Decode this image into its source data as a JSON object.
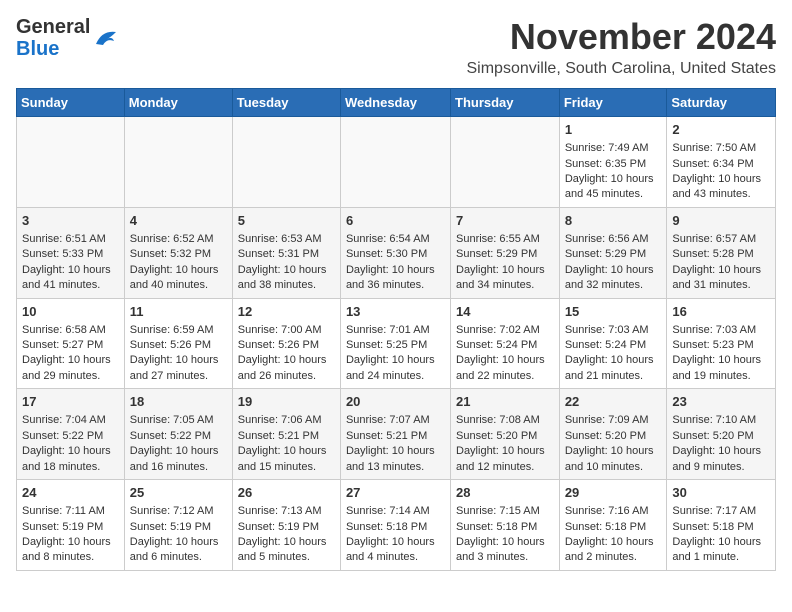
{
  "logo": {
    "line1": "General",
    "line2": "Blue"
  },
  "title": "November 2024",
  "location": "Simpsonville, South Carolina, United States",
  "weekdays": [
    "Sunday",
    "Monday",
    "Tuesday",
    "Wednesday",
    "Thursday",
    "Friday",
    "Saturday"
  ],
  "weeks": [
    [
      {
        "day": "",
        "data": ""
      },
      {
        "day": "",
        "data": ""
      },
      {
        "day": "",
        "data": ""
      },
      {
        "day": "",
        "data": ""
      },
      {
        "day": "",
        "data": ""
      },
      {
        "day": "1",
        "data": "Sunrise: 7:49 AM\nSunset: 6:35 PM\nDaylight: 10 hours and 45 minutes."
      },
      {
        "day": "2",
        "data": "Sunrise: 7:50 AM\nSunset: 6:34 PM\nDaylight: 10 hours and 43 minutes."
      }
    ],
    [
      {
        "day": "3",
        "data": "Sunrise: 6:51 AM\nSunset: 5:33 PM\nDaylight: 10 hours and 41 minutes."
      },
      {
        "day": "4",
        "data": "Sunrise: 6:52 AM\nSunset: 5:32 PM\nDaylight: 10 hours and 40 minutes."
      },
      {
        "day": "5",
        "data": "Sunrise: 6:53 AM\nSunset: 5:31 PM\nDaylight: 10 hours and 38 minutes."
      },
      {
        "day": "6",
        "data": "Sunrise: 6:54 AM\nSunset: 5:30 PM\nDaylight: 10 hours and 36 minutes."
      },
      {
        "day": "7",
        "data": "Sunrise: 6:55 AM\nSunset: 5:29 PM\nDaylight: 10 hours and 34 minutes."
      },
      {
        "day": "8",
        "data": "Sunrise: 6:56 AM\nSunset: 5:29 PM\nDaylight: 10 hours and 32 minutes."
      },
      {
        "day": "9",
        "data": "Sunrise: 6:57 AM\nSunset: 5:28 PM\nDaylight: 10 hours and 31 minutes."
      }
    ],
    [
      {
        "day": "10",
        "data": "Sunrise: 6:58 AM\nSunset: 5:27 PM\nDaylight: 10 hours and 29 minutes."
      },
      {
        "day": "11",
        "data": "Sunrise: 6:59 AM\nSunset: 5:26 PM\nDaylight: 10 hours and 27 minutes."
      },
      {
        "day": "12",
        "data": "Sunrise: 7:00 AM\nSunset: 5:26 PM\nDaylight: 10 hours and 26 minutes."
      },
      {
        "day": "13",
        "data": "Sunrise: 7:01 AM\nSunset: 5:25 PM\nDaylight: 10 hours and 24 minutes."
      },
      {
        "day": "14",
        "data": "Sunrise: 7:02 AM\nSunset: 5:24 PM\nDaylight: 10 hours and 22 minutes."
      },
      {
        "day": "15",
        "data": "Sunrise: 7:03 AM\nSunset: 5:24 PM\nDaylight: 10 hours and 21 minutes."
      },
      {
        "day": "16",
        "data": "Sunrise: 7:03 AM\nSunset: 5:23 PM\nDaylight: 10 hours and 19 minutes."
      }
    ],
    [
      {
        "day": "17",
        "data": "Sunrise: 7:04 AM\nSunset: 5:22 PM\nDaylight: 10 hours and 18 minutes."
      },
      {
        "day": "18",
        "data": "Sunrise: 7:05 AM\nSunset: 5:22 PM\nDaylight: 10 hours and 16 minutes."
      },
      {
        "day": "19",
        "data": "Sunrise: 7:06 AM\nSunset: 5:21 PM\nDaylight: 10 hours and 15 minutes."
      },
      {
        "day": "20",
        "data": "Sunrise: 7:07 AM\nSunset: 5:21 PM\nDaylight: 10 hours and 13 minutes."
      },
      {
        "day": "21",
        "data": "Sunrise: 7:08 AM\nSunset: 5:20 PM\nDaylight: 10 hours and 12 minutes."
      },
      {
        "day": "22",
        "data": "Sunrise: 7:09 AM\nSunset: 5:20 PM\nDaylight: 10 hours and 10 minutes."
      },
      {
        "day": "23",
        "data": "Sunrise: 7:10 AM\nSunset: 5:20 PM\nDaylight: 10 hours and 9 minutes."
      }
    ],
    [
      {
        "day": "24",
        "data": "Sunrise: 7:11 AM\nSunset: 5:19 PM\nDaylight: 10 hours and 8 minutes."
      },
      {
        "day": "25",
        "data": "Sunrise: 7:12 AM\nSunset: 5:19 PM\nDaylight: 10 hours and 6 minutes."
      },
      {
        "day": "26",
        "data": "Sunrise: 7:13 AM\nSunset: 5:19 PM\nDaylight: 10 hours and 5 minutes."
      },
      {
        "day": "27",
        "data": "Sunrise: 7:14 AM\nSunset: 5:18 PM\nDaylight: 10 hours and 4 minutes."
      },
      {
        "day": "28",
        "data": "Sunrise: 7:15 AM\nSunset: 5:18 PM\nDaylight: 10 hours and 3 minutes."
      },
      {
        "day": "29",
        "data": "Sunrise: 7:16 AM\nSunset: 5:18 PM\nDaylight: 10 hours and 2 minutes."
      },
      {
        "day": "30",
        "data": "Sunrise: 7:17 AM\nSunset: 5:18 PM\nDaylight: 10 hours and 1 minute."
      }
    ]
  ]
}
